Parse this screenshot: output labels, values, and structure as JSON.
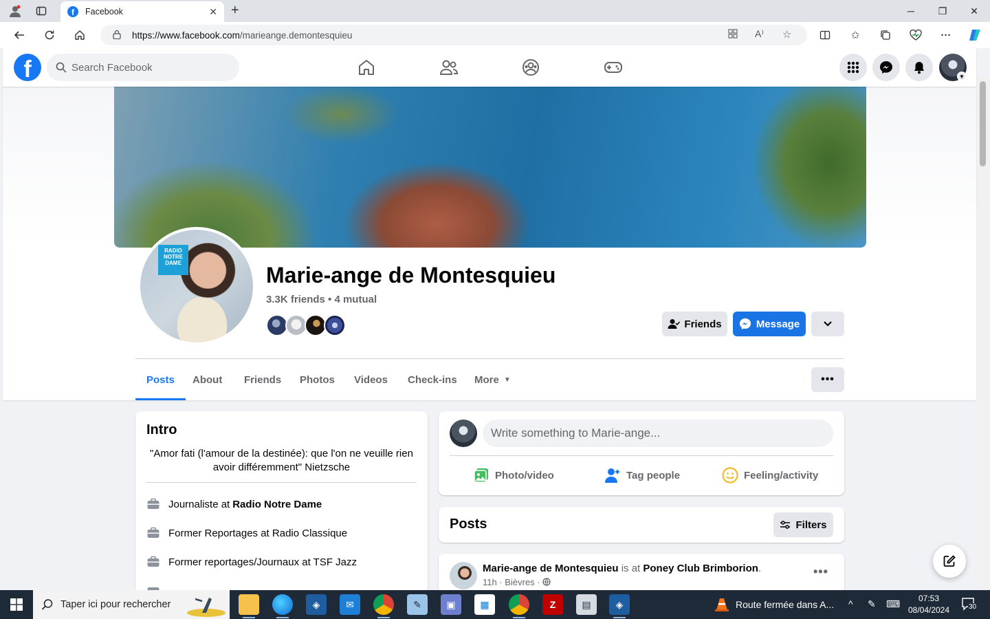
{
  "browser": {
    "tab_title": "Facebook",
    "url_domain": "https://www.facebook.com",
    "url_path": "/marieange.demontesquieu"
  },
  "header": {
    "search_placeholder": "Search Facebook"
  },
  "profile": {
    "name": "Marie-ange de Montesquieu",
    "friends_line": "3.3K friends • 4 mutual",
    "avatar_text": "RADIO NOTRE DAME",
    "friends_button": "Friends",
    "message_button": "Message",
    "tabs": [
      "Posts",
      "About",
      "Friends",
      "Photos",
      "Videos",
      "Check-ins",
      "More"
    ]
  },
  "intro": {
    "title": "Intro",
    "bio": "\"Amor fati (l'amour de la destinée): que l'on ne veuille rien avoir différemment\" Nietzsche",
    "items": [
      {
        "prefix": "Journaliste at",
        "org": "Radio Notre Dame"
      },
      {
        "prefix": "Former Reportages at Radio Classique",
        "org": ""
      },
      {
        "prefix": "Former reportages/Journaux at TSF Jazz",
        "org": ""
      }
    ]
  },
  "composer": {
    "placeholder": "Write something to Marie-ange...",
    "photo_video": "Photo/video",
    "tag_people": "Tag people",
    "feeling": "Feeling/activity"
  },
  "posts": {
    "title": "Posts",
    "filters": "Filters",
    "first_post": {
      "author": "Marie-ange de Montesquieu",
      "connector": "is at",
      "place": "Poney Club Brimborion",
      "time": "11h · Bièvres ·"
    }
  },
  "taskbar": {
    "search_placeholder": "Taper ici pour rechercher",
    "news": "Route fermée dans A...",
    "time": "07:53",
    "date": "08/04/2024",
    "notifications": "30"
  },
  "colors": {
    "facebook_blue": "#1877f2",
    "button_gray": "#e4e6eb",
    "page_bg": "#f0f2f5"
  }
}
